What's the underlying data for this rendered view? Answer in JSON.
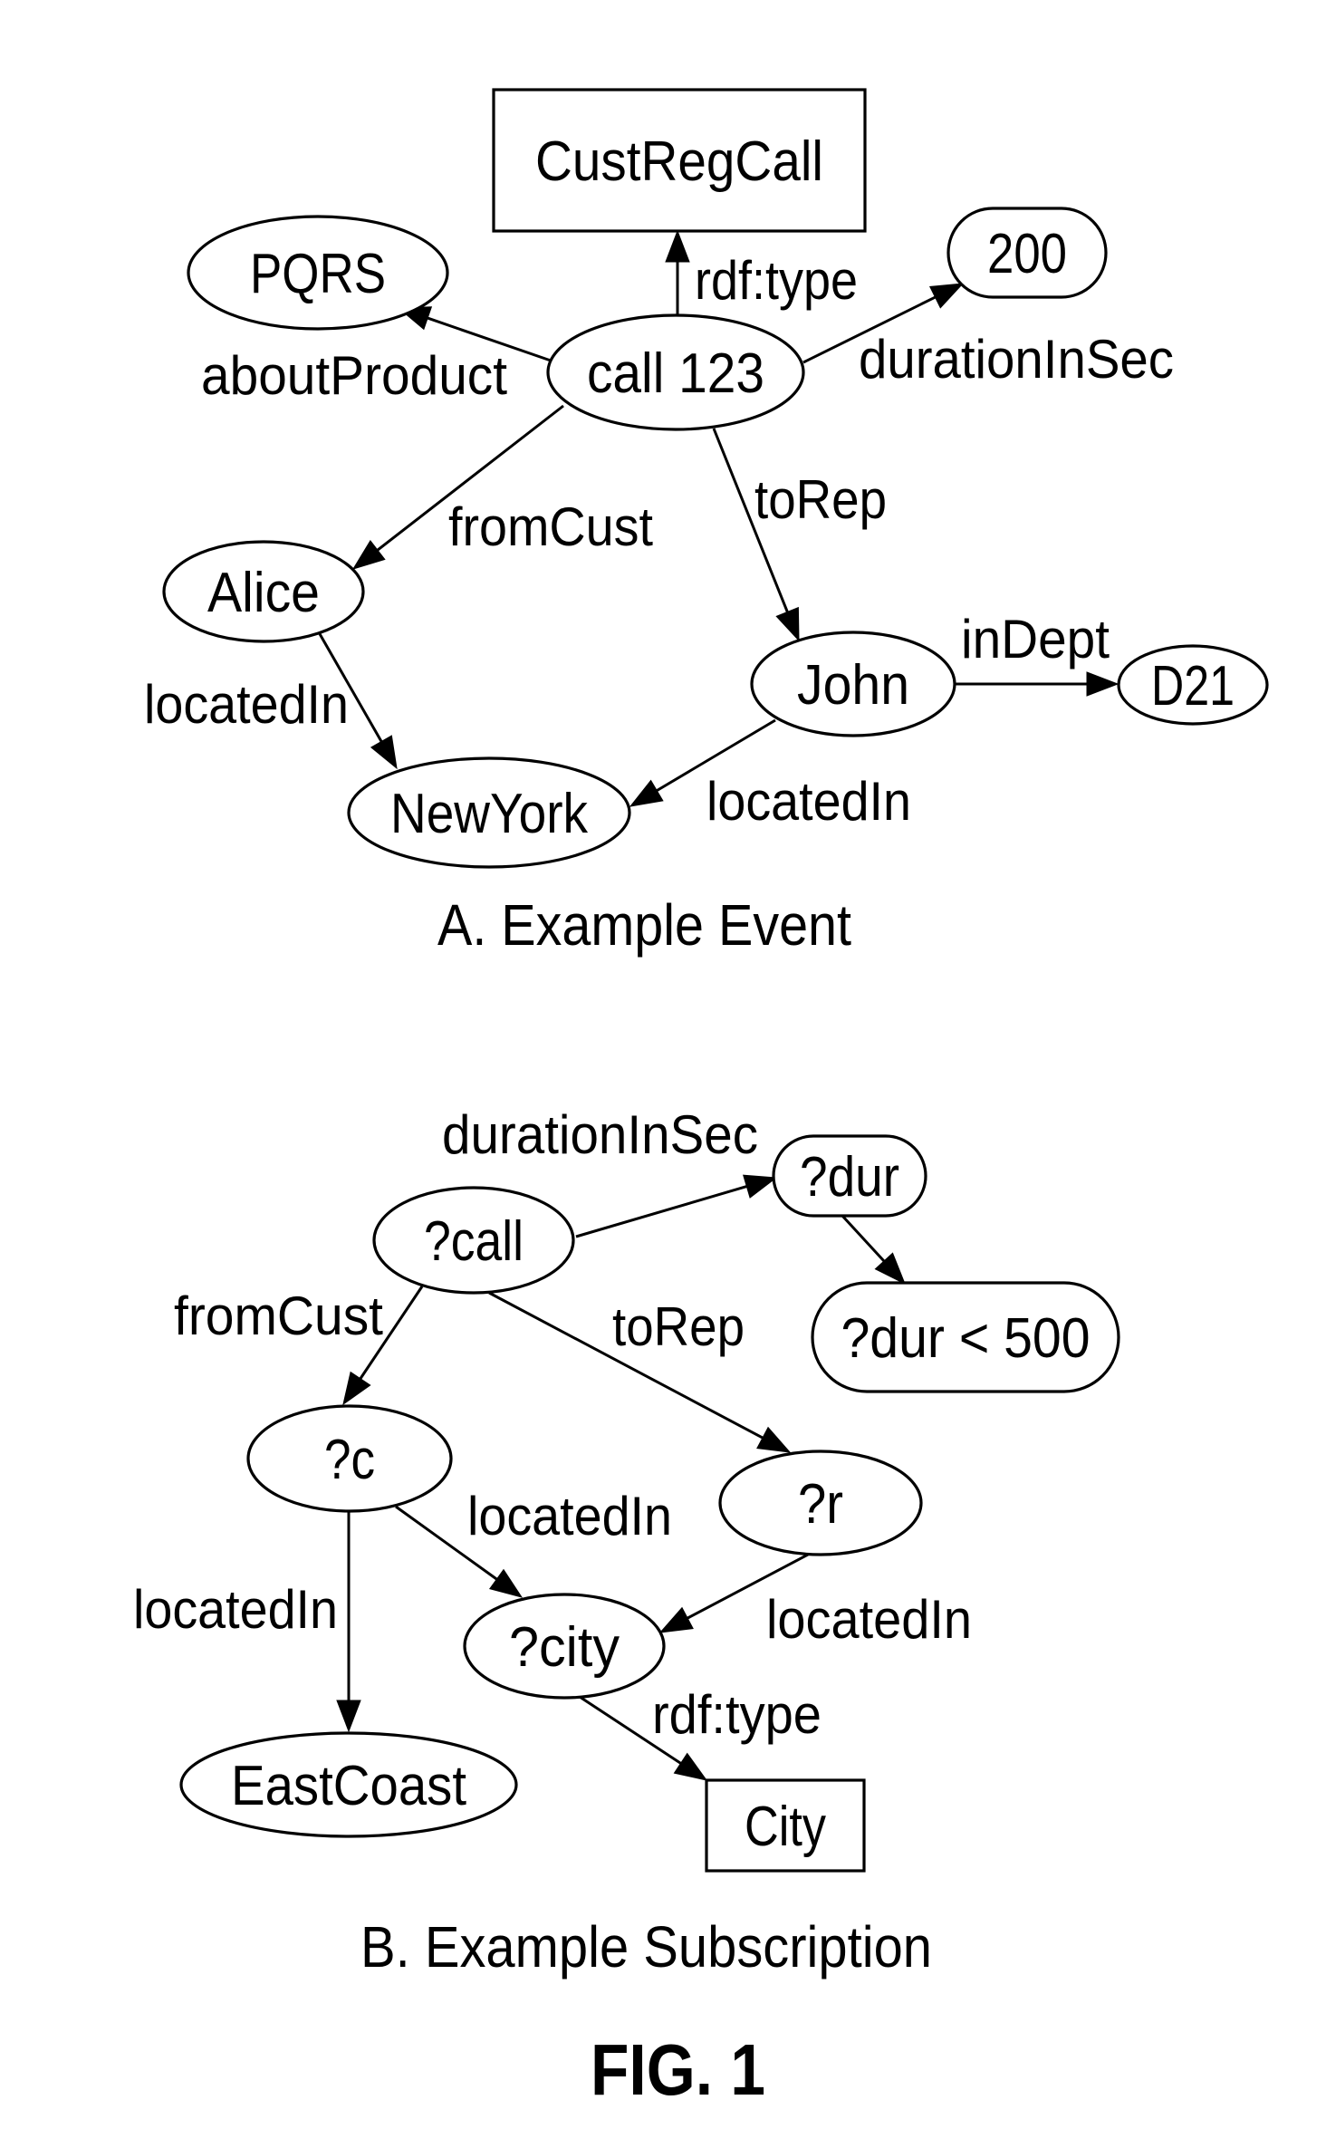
{
  "figure": {
    "label": "FIG. 1"
  },
  "panels": [
    {
      "id": "event",
      "caption": "A. Example Event",
      "nodes": [
        {
          "id": "custregcall",
          "label": "CustRegCall",
          "shape": "rect"
        },
        {
          "id": "pqrs",
          "label": "PQRS",
          "shape": "ellipse"
        },
        {
          "id": "call123",
          "label": "call 123",
          "shape": "ellipse"
        },
        {
          "id": "n200",
          "label": "200",
          "shape": "pill"
        },
        {
          "id": "alice",
          "label": "Alice",
          "shape": "ellipse"
        },
        {
          "id": "john",
          "label": "John",
          "shape": "ellipse"
        },
        {
          "id": "d21",
          "label": "D21",
          "shape": "ellipse"
        },
        {
          "id": "newyork",
          "label": "NewYork",
          "shape": "ellipse"
        }
      ],
      "edges": [
        {
          "id": "e-type",
          "from": "call123",
          "to": "custregcall",
          "label": "rdf:type"
        },
        {
          "id": "e-product",
          "from": "call123",
          "to": "pqrs",
          "label": "aboutProduct"
        },
        {
          "id": "e-duration",
          "from": "call123",
          "to": "n200",
          "label": "durationInSec"
        },
        {
          "id": "e-fromcust",
          "from": "call123",
          "to": "alice",
          "label": "fromCust"
        },
        {
          "id": "e-torep",
          "from": "call123",
          "to": "john",
          "label": "toRep"
        },
        {
          "id": "e-indept",
          "from": "john",
          "to": "d21",
          "label": "inDept"
        },
        {
          "id": "e-alice-loc",
          "from": "alice",
          "to": "newyork",
          "label": "locatedIn"
        },
        {
          "id": "e-john-loc",
          "from": "john",
          "to": "newyork",
          "label": "locatedIn"
        }
      ]
    },
    {
      "id": "subscription",
      "caption": "B. Example Subscription",
      "nodes": [
        {
          "id": "qcall",
          "label": "?call",
          "shape": "ellipse"
        },
        {
          "id": "qdur",
          "label": "?dur",
          "shape": "pill"
        },
        {
          "id": "qdurcond",
          "label": "?dur < 500",
          "shape": "pill"
        },
        {
          "id": "qc",
          "label": "?c",
          "shape": "ellipse"
        },
        {
          "id": "qr",
          "label": "?r",
          "shape": "ellipse"
        },
        {
          "id": "qcity",
          "label": "?city",
          "shape": "ellipse"
        },
        {
          "id": "eastcoast",
          "label": "EastCoast",
          "shape": "ellipse"
        },
        {
          "id": "city",
          "label": "City",
          "shape": "rect"
        }
      ],
      "edges": [
        {
          "id": "s-duration",
          "from": "qcall",
          "to": "qdur",
          "label": "durationInSec"
        },
        {
          "id": "s-cond",
          "from": "qdur",
          "to": "qdurcond",
          "label": ""
        },
        {
          "id": "s-fromcust",
          "from": "qcall",
          "to": "qc",
          "label": "fromCust"
        },
        {
          "id": "s-torep",
          "from": "qcall",
          "to": "qr",
          "label": "toRep"
        },
        {
          "id": "s-c-east",
          "from": "qc",
          "to": "eastcoast",
          "label": "locatedIn"
        },
        {
          "id": "s-c-city",
          "from": "qc",
          "to": "qcity",
          "label": "locatedIn"
        },
        {
          "id": "s-r-city",
          "from": "qr",
          "to": "qcity",
          "label": "locatedIn"
        },
        {
          "id": "s-type",
          "from": "qcity",
          "to": "city",
          "label": "rdf:type"
        }
      ]
    }
  ]
}
